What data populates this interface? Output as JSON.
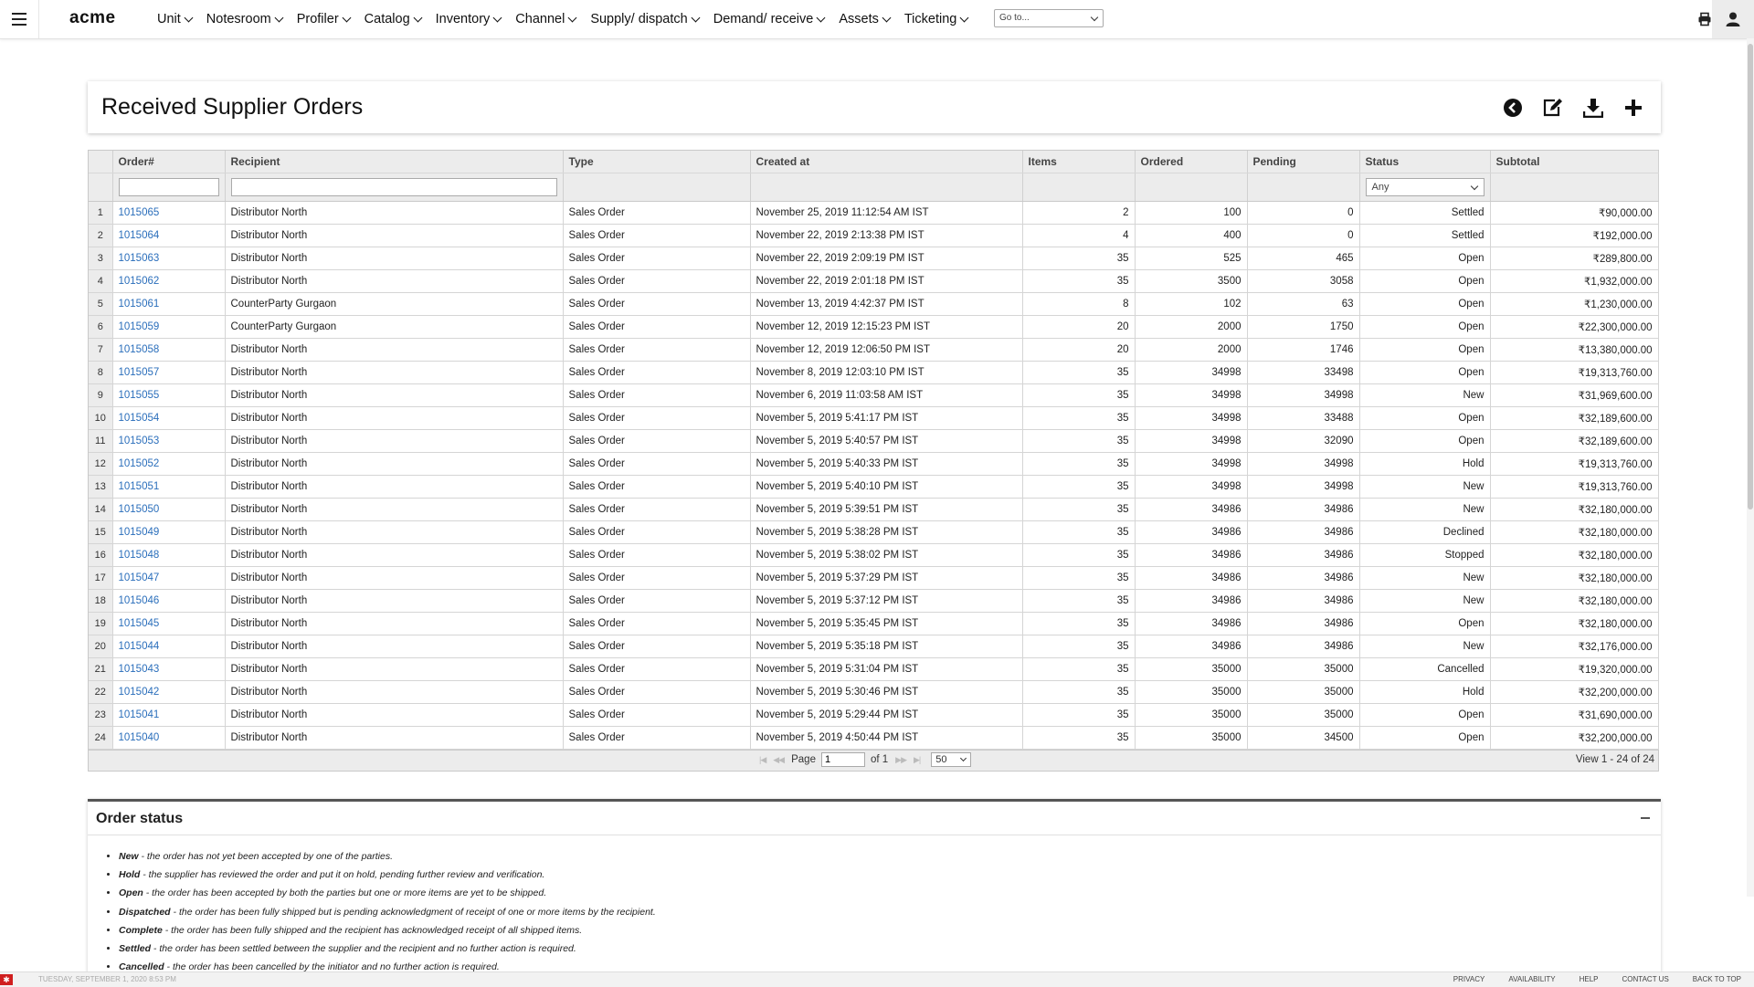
{
  "nav": {
    "logo": "acme",
    "menu": [
      "Unit",
      "Notesroom",
      "Profiler",
      "Catalog",
      "Inventory",
      "Channel",
      "Supply/ dispatch",
      "Demand/ receive",
      "Assets",
      "Ticketing"
    ],
    "goto_placeholder": "Go to..."
  },
  "page": {
    "title": "Received Supplier Orders"
  },
  "table": {
    "columns": [
      "Order#",
      "Recipient",
      "Type",
      "Created at",
      "Items",
      "Ordered",
      "Pending",
      "Status",
      "Subtotal"
    ],
    "status_filter": "Any",
    "rows": [
      [
        "1",
        "1015065",
        "Distributor North",
        "Sales Order",
        "November 25, 2019 11:12:54 AM IST",
        "2",
        "100",
        "0",
        "Settled",
        "₹90,000.00"
      ],
      [
        "2",
        "1015064",
        "Distributor North",
        "Sales Order",
        "November 22, 2019 2:13:38 PM IST",
        "4",
        "400",
        "0",
        "Settled",
        "₹192,000.00"
      ],
      [
        "3",
        "1015063",
        "Distributor North",
        "Sales Order",
        "November 22, 2019 2:09:19 PM IST",
        "35",
        "525",
        "465",
        "Open",
        "₹289,800.00"
      ],
      [
        "4",
        "1015062",
        "Distributor North",
        "Sales Order",
        "November 22, 2019 2:01:18 PM IST",
        "35",
        "3500",
        "3058",
        "Open",
        "₹1,932,000.00"
      ],
      [
        "5",
        "1015061",
        "CounterParty Gurgaon",
        "Sales Order",
        "November 13, 2019 4:42:37 PM IST",
        "8",
        "102",
        "63",
        "Open",
        "₹1,230,000.00"
      ],
      [
        "6",
        "1015059",
        "CounterParty Gurgaon",
        "Sales Order",
        "November 12, 2019 12:15:23 PM IST",
        "20",
        "2000",
        "1750",
        "Open",
        "₹22,300,000.00"
      ],
      [
        "7",
        "1015058",
        "Distributor North",
        "Sales Order",
        "November 12, 2019 12:06:50 PM IST",
        "20",
        "2000",
        "1746",
        "Open",
        "₹13,380,000.00"
      ],
      [
        "8",
        "1015057",
        "Distributor North",
        "Sales Order",
        "November 8, 2019 12:03:10 PM IST",
        "35",
        "34998",
        "33498",
        "Open",
        "₹19,313,760.00"
      ],
      [
        "9",
        "1015055",
        "Distributor North",
        "Sales Order",
        "November 6, 2019 11:03:58 AM IST",
        "35",
        "34998",
        "34998",
        "New",
        "₹31,969,600.00"
      ],
      [
        "10",
        "1015054",
        "Distributor North",
        "Sales Order",
        "November 5, 2019 5:41:17 PM IST",
        "35",
        "34998",
        "33488",
        "Open",
        "₹32,189,600.00"
      ],
      [
        "11",
        "1015053",
        "Distributor North",
        "Sales Order",
        "November 5, 2019 5:40:57 PM IST",
        "35",
        "34998",
        "32090",
        "Open",
        "₹32,189,600.00"
      ],
      [
        "12",
        "1015052",
        "Distributor North",
        "Sales Order",
        "November 5, 2019 5:40:33 PM IST",
        "35",
        "34998",
        "34998",
        "Hold",
        "₹19,313,760.00"
      ],
      [
        "13",
        "1015051",
        "Distributor North",
        "Sales Order",
        "November 5, 2019 5:40:10 PM IST",
        "35",
        "34998",
        "34998",
        "New",
        "₹19,313,760.00"
      ],
      [
        "14",
        "1015050",
        "Distributor North",
        "Sales Order",
        "November 5, 2019 5:39:51 PM IST",
        "35",
        "34986",
        "34986",
        "New",
        "₹32,180,000.00"
      ],
      [
        "15",
        "1015049",
        "Distributor North",
        "Sales Order",
        "November 5, 2019 5:38:28 PM IST",
        "35",
        "34986",
        "34986",
        "Declined",
        "₹32,180,000.00"
      ],
      [
        "16",
        "1015048",
        "Distributor North",
        "Sales Order",
        "November 5, 2019 5:38:02 PM IST",
        "35",
        "34986",
        "34986",
        "Stopped",
        "₹32,180,000.00"
      ],
      [
        "17",
        "1015047",
        "Distributor North",
        "Sales Order",
        "November 5, 2019 5:37:29 PM IST",
        "35",
        "34986",
        "34986",
        "New",
        "₹32,180,000.00"
      ],
      [
        "18",
        "1015046",
        "Distributor North",
        "Sales Order",
        "November 5, 2019 5:37:12 PM IST",
        "35",
        "34986",
        "34986",
        "New",
        "₹32,180,000.00"
      ],
      [
        "19",
        "1015045",
        "Distributor North",
        "Sales Order",
        "November 5, 2019 5:35:45 PM IST",
        "35",
        "34986",
        "34986",
        "Open",
        "₹32,180,000.00"
      ],
      [
        "20",
        "1015044",
        "Distributor North",
        "Sales Order",
        "November 5, 2019 5:35:18 PM IST",
        "35",
        "34986",
        "34986",
        "New",
        "₹32,176,000.00"
      ],
      [
        "21",
        "1015043",
        "Distributor North",
        "Sales Order",
        "November 5, 2019 5:31:04 PM IST",
        "35",
        "35000",
        "35000",
        "Cancelled",
        "₹19,320,000.00"
      ],
      [
        "22",
        "1015042",
        "Distributor North",
        "Sales Order",
        "November 5, 2019 5:30:46 PM IST",
        "35",
        "35000",
        "35000",
        "Hold",
        "₹32,200,000.00"
      ],
      [
        "23",
        "1015041",
        "Distributor North",
        "Sales Order",
        "November 5, 2019 5:29:44 PM IST",
        "35",
        "35000",
        "35000",
        "Open",
        "₹31,690,000.00"
      ],
      [
        "24",
        "1015040",
        "Distributor North",
        "Sales Order",
        "November 5, 2019 4:50:44 PM IST",
        "35",
        "35000",
        "34500",
        "Open",
        "₹32,200,000.00"
      ]
    ]
  },
  "pager": {
    "page_label": "Page",
    "page_value": "1",
    "of_label": "of 1",
    "page_size": "50",
    "view_text": "View 1 - 24 of 24"
  },
  "order_status": {
    "title": "Order status",
    "items": [
      {
        "term": "New",
        "desc": " - the order has not yet been accepted by one of the parties."
      },
      {
        "term": "Hold",
        "desc": " - the supplier has reviewed the order and put it on hold, pending further review and verification."
      },
      {
        "term": "Open",
        "desc": " - the order has been accepted by both the parties but one or more items are yet to be shipped."
      },
      {
        "term": "Dispatched",
        "desc": " - the order has been fully shipped but is pending acknowledgment of receipt of one or more items by the recipient."
      },
      {
        "term": "Complete",
        "desc": " - the order has been fully shipped and the recipient has acknowledged receipt of all shipped items."
      },
      {
        "term": "Settled",
        "desc": " - the order has been settled between the supplier and the recipient and no further action is required."
      },
      {
        "term": "Cancelled",
        "desc": " - the order has been cancelled by the initiator and no further action is required."
      }
    ]
  },
  "footer": {
    "date": "TUESDAY, SEPTEMBER 1, 2020 8:53 PM",
    "links": [
      "PRIVACY",
      "AVAILABILITY",
      "HELP",
      "CONTACT US",
      "BACK TO TOP"
    ]
  },
  "colors": {
    "link": "#2a6ebb",
    "header_bg": "#ececec",
    "flag": "#d01f1f"
  }
}
